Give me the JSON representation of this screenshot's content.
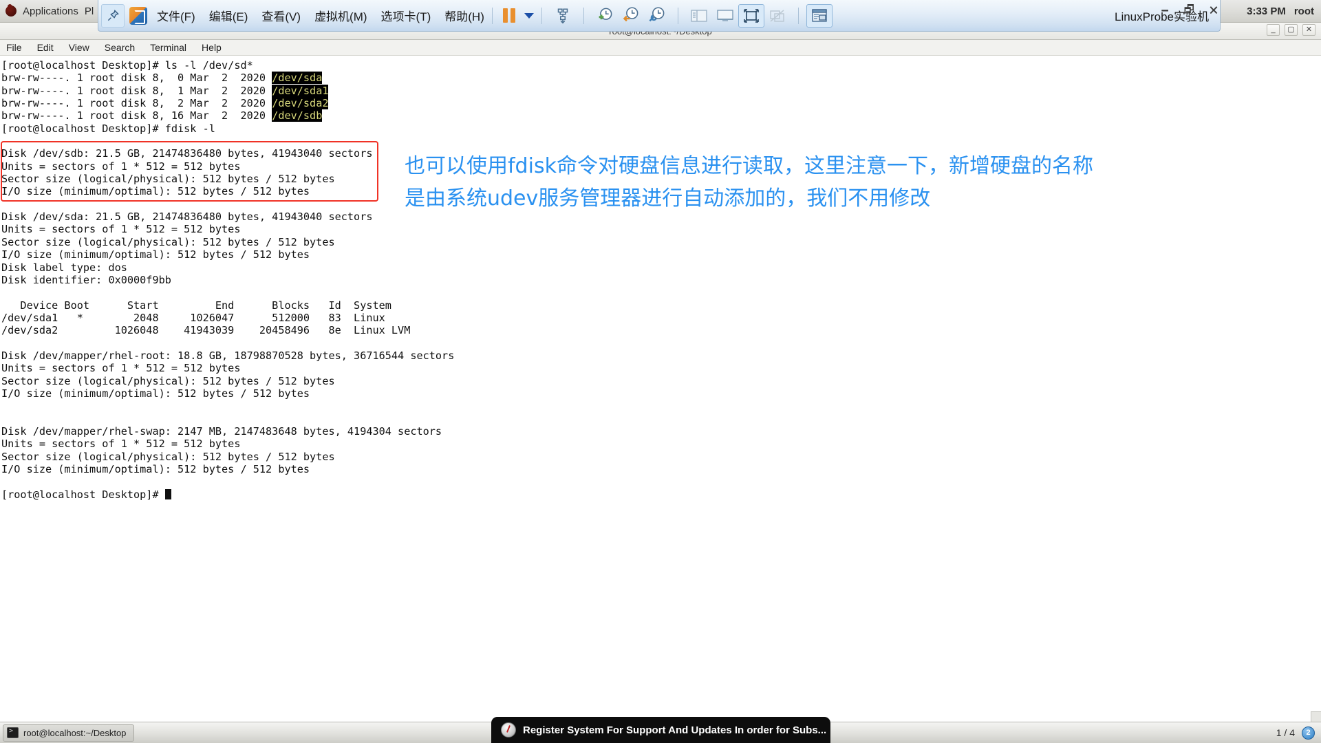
{
  "gnome_panel": {
    "logo_icon": "fedora-logo-icon",
    "applications_label": "Applications",
    "places_label": "Pl",
    "clock": "3:33 PM",
    "user": "root",
    "close_glyph": "✕"
  },
  "vmware": {
    "pin_icon": "pin-icon",
    "app_icon": "vmware-app-icon",
    "menu": [
      {
        "name": "menu-file",
        "label": "文件(F)"
      },
      {
        "name": "menu-edit",
        "label": "编辑(E)"
      },
      {
        "name": "menu-view",
        "label": "查看(V)"
      },
      {
        "name": "menu-vm",
        "label": "虚拟机(M)"
      },
      {
        "name": "menu-tabs",
        "label": "选项卡(T)"
      },
      {
        "name": "menu-help",
        "label": "帮助(H)"
      }
    ],
    "toolbar_icons": [
      "pause-icon",
      "dropdown-caret-icon",
      "send-ctrl-alt-del-icon",
      "snapshot-add-icon",
      "snapshot-revert-icon",
      "snapshot-manager-icon",
      "show-library-icon",
      "show-console-view-icon",
      "full-screen-icon",
      "unity-mode-icon",
      "show-thumbnails-icon"
    ],
    "title": "LinuxProbe实验机",
    "window_controls": [
      "minimize-icon",
      "restore-icon",
      "close-icon"
    ]
  },
  "terminal": {
    "window_title": "root@localhost:~/Desktop",
    "window_buttons": [
      "minimize-button",
      "maximize-button",
      "close-button"
    ],
    "menu": [
      "File",
      "Edit",
      "View",
      "Search",
      "Terminal",
      "Help"
    ],
    "lines": [
      {
        "type": "cmd",
        "text": "[root@localhost Desktop]# ls -l /dev/sd*"
      },
      {
        "type": "dev",
        "prefix": "brw-rw----. 1 root disk 8,  0 Mar  2  2020 ",
        "dev": "/dev/sda"
      },
      {
        "type": "dev",
        "prefix": "brw-rw----. 1 root disk 8,  1 Mar  2  2020 ",
        "dev": "/dev/sda1"
      },
      {
        "type": "dev",
        "prefix": "brw-rw----. 1 root disk 8,  2 Mar  2  2020 ",
        "dev": "/dev/sda2"
      },
      {
        "type": "dev",
        "prefix": "brw-rw----. 1 root disk 8, 16 Mar  2  2020 ",
        "dev": "/dev/sdb"
      },
      {
        "type": "cmd",
        "text": "[root@localhost Desktop]# fdisk -l"
      },
      {
        "type": "blank",
        "text": ""
      },
      {
        "type": "out",
        "text": "Disk /dev/sdb: 21.5 GB, 21474836480 bytes, 41943040 sectors"
      },
      {
        "type": "out",
        "text": "Units = sectors of 1 * 512 = 512 bytes"
      },
      {
        "type": "out",
        "text": "Sector size (logical/physical): 512 bytes / 512 bytes"
      },
      {
        "type": "out",
        "text": "I/O size (minimum/optimal): 512 bytes / 512 bytes"
      },
      {
        "type": "blank",
        "text": ""
      },
      {
        "type": "out",
        "text": "Disk /dev/sda: 21.5 GB, 21474836480 bytes, 41943040 sectors"
      },
      {
        "type": "out",
        "text": "Units = sectors of 1 * 512 = 512 bytes"
      },
      {
        "type": "out",
        "text": "Sector size (logical/physical): 512 bytes / 512 bytes"
      },
      {
        "type": "out",
        "text": "I/O size (minimum/optimal): 512 bytes / 512 bytes"
      },
      {
        "type": "out",
        "text": "Disk label type: dos"
      },
      {
        "type": "out",
        "text": "Disk identifier: 0x0000f9bb"
      },
      {
        "type": "blank",
        "text": ""
      },
      {
        "type": "out",
        "text": "   Device Boot      Start         End      Blocks   Id  System"
      },
      {
        "type": "out",
        "text": "/dev/sda1   *        2048     1026047      512000   83  Linux"
      },
      {
        "type": "out",
        "text": "/dev/sda2         1026048    41943039    20458496   8e  Linux LVM"
      },
      {
        "type": "blank",
        "text": ""
      },
      {
        "type": "out",
        "text": "Disk /dev/mapper/rhel-root: 18.8 GB, 18798870528 bytes, 36716544 sectors"
      },
      {
        "type": "out",
        "text": "Units = sectors of 1 * 512 = 512 bytes"
      },
      {
        "type": "out",
        "text": "Sector size (logical/physical): 512 bytes / 512 bytes"
      },
      {
        "type": "out",
        "text": "I/O size (minimum/optimal): 512 bytes / 512 bytes"
      },
      {
        "type": "blank",
        "text": ""
      },
      {
        "type": "blank",
        "text": ""
      },
      {
        "type": "out",
        "text": "Disk /dev/mapper/rhel-swap: 2147 MB, 2147483648 bytes, 4194304 sectors"
      },
      {
        "type": "out",
        "text": "Units = sectors of 1 * 512 = 512 bytes"
      },
      {
        "type": "out",
        "text": "Sector size (logical/physical): 512 bytes / 512 bytes"
      },
      {
        "type": "out",
        "text": "I/O size (minimum/optimal): 512 bytes / 512 bytes"
      },
      {
        "type": "blank",
        "text": ""
      },
      {
        "type": "prompt",
        "text": "[root@localhost Desktop]# "
      }
    ]
  },
  "annotation": {
    "box_color": "#f03226",
    "text_color": "#2a91f0",
    "line1": "也可以使用fdisk命令对硬盘信息进行读取，这里注意一下，新增硬盘的名称",
    "line2": "是由系统udev服务管理器进行自动添加的，我们不用修改"
  },
  "taskbar": {
    "window_icon": "terminal-icon",
    "window_label": "root@localhost:~/Desktop",
    "page_indicator": "1 / 4",
    "workspace_badge": "2"
  },
  "notification": {
    "icon": "subscription-warning-icon",
    "text": "Register System For Support And Updates  In order for Subs..."
  }
}
